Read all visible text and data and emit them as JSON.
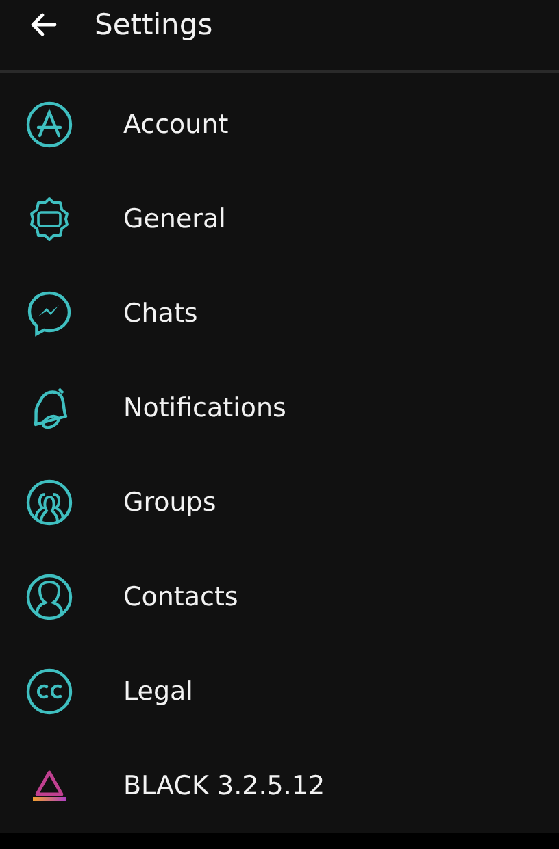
{
  "header": {
    "title": "Settings"
  },
  "items": [
    {
      "label": "Account",
      "kind": "account"
    },
    {
      "label": "General",
      "kind": "general"
    },
    {
      "label": "Chats",
      "kind": "chats"
    },
    {
      "label": "Notifications",
      "kind": "notifications"
    },
    {
      "label": "Groups",
      "kind": "groups"
    },
    {
      "label": "Contacts",
      "kind": "contacts"
    },
    {
      "label": "Legal",
      "kind": "legal"
    },
    {
      "label": "BLACK 3.2.5.12",
      "kind": "version"
    }
  ]
}
